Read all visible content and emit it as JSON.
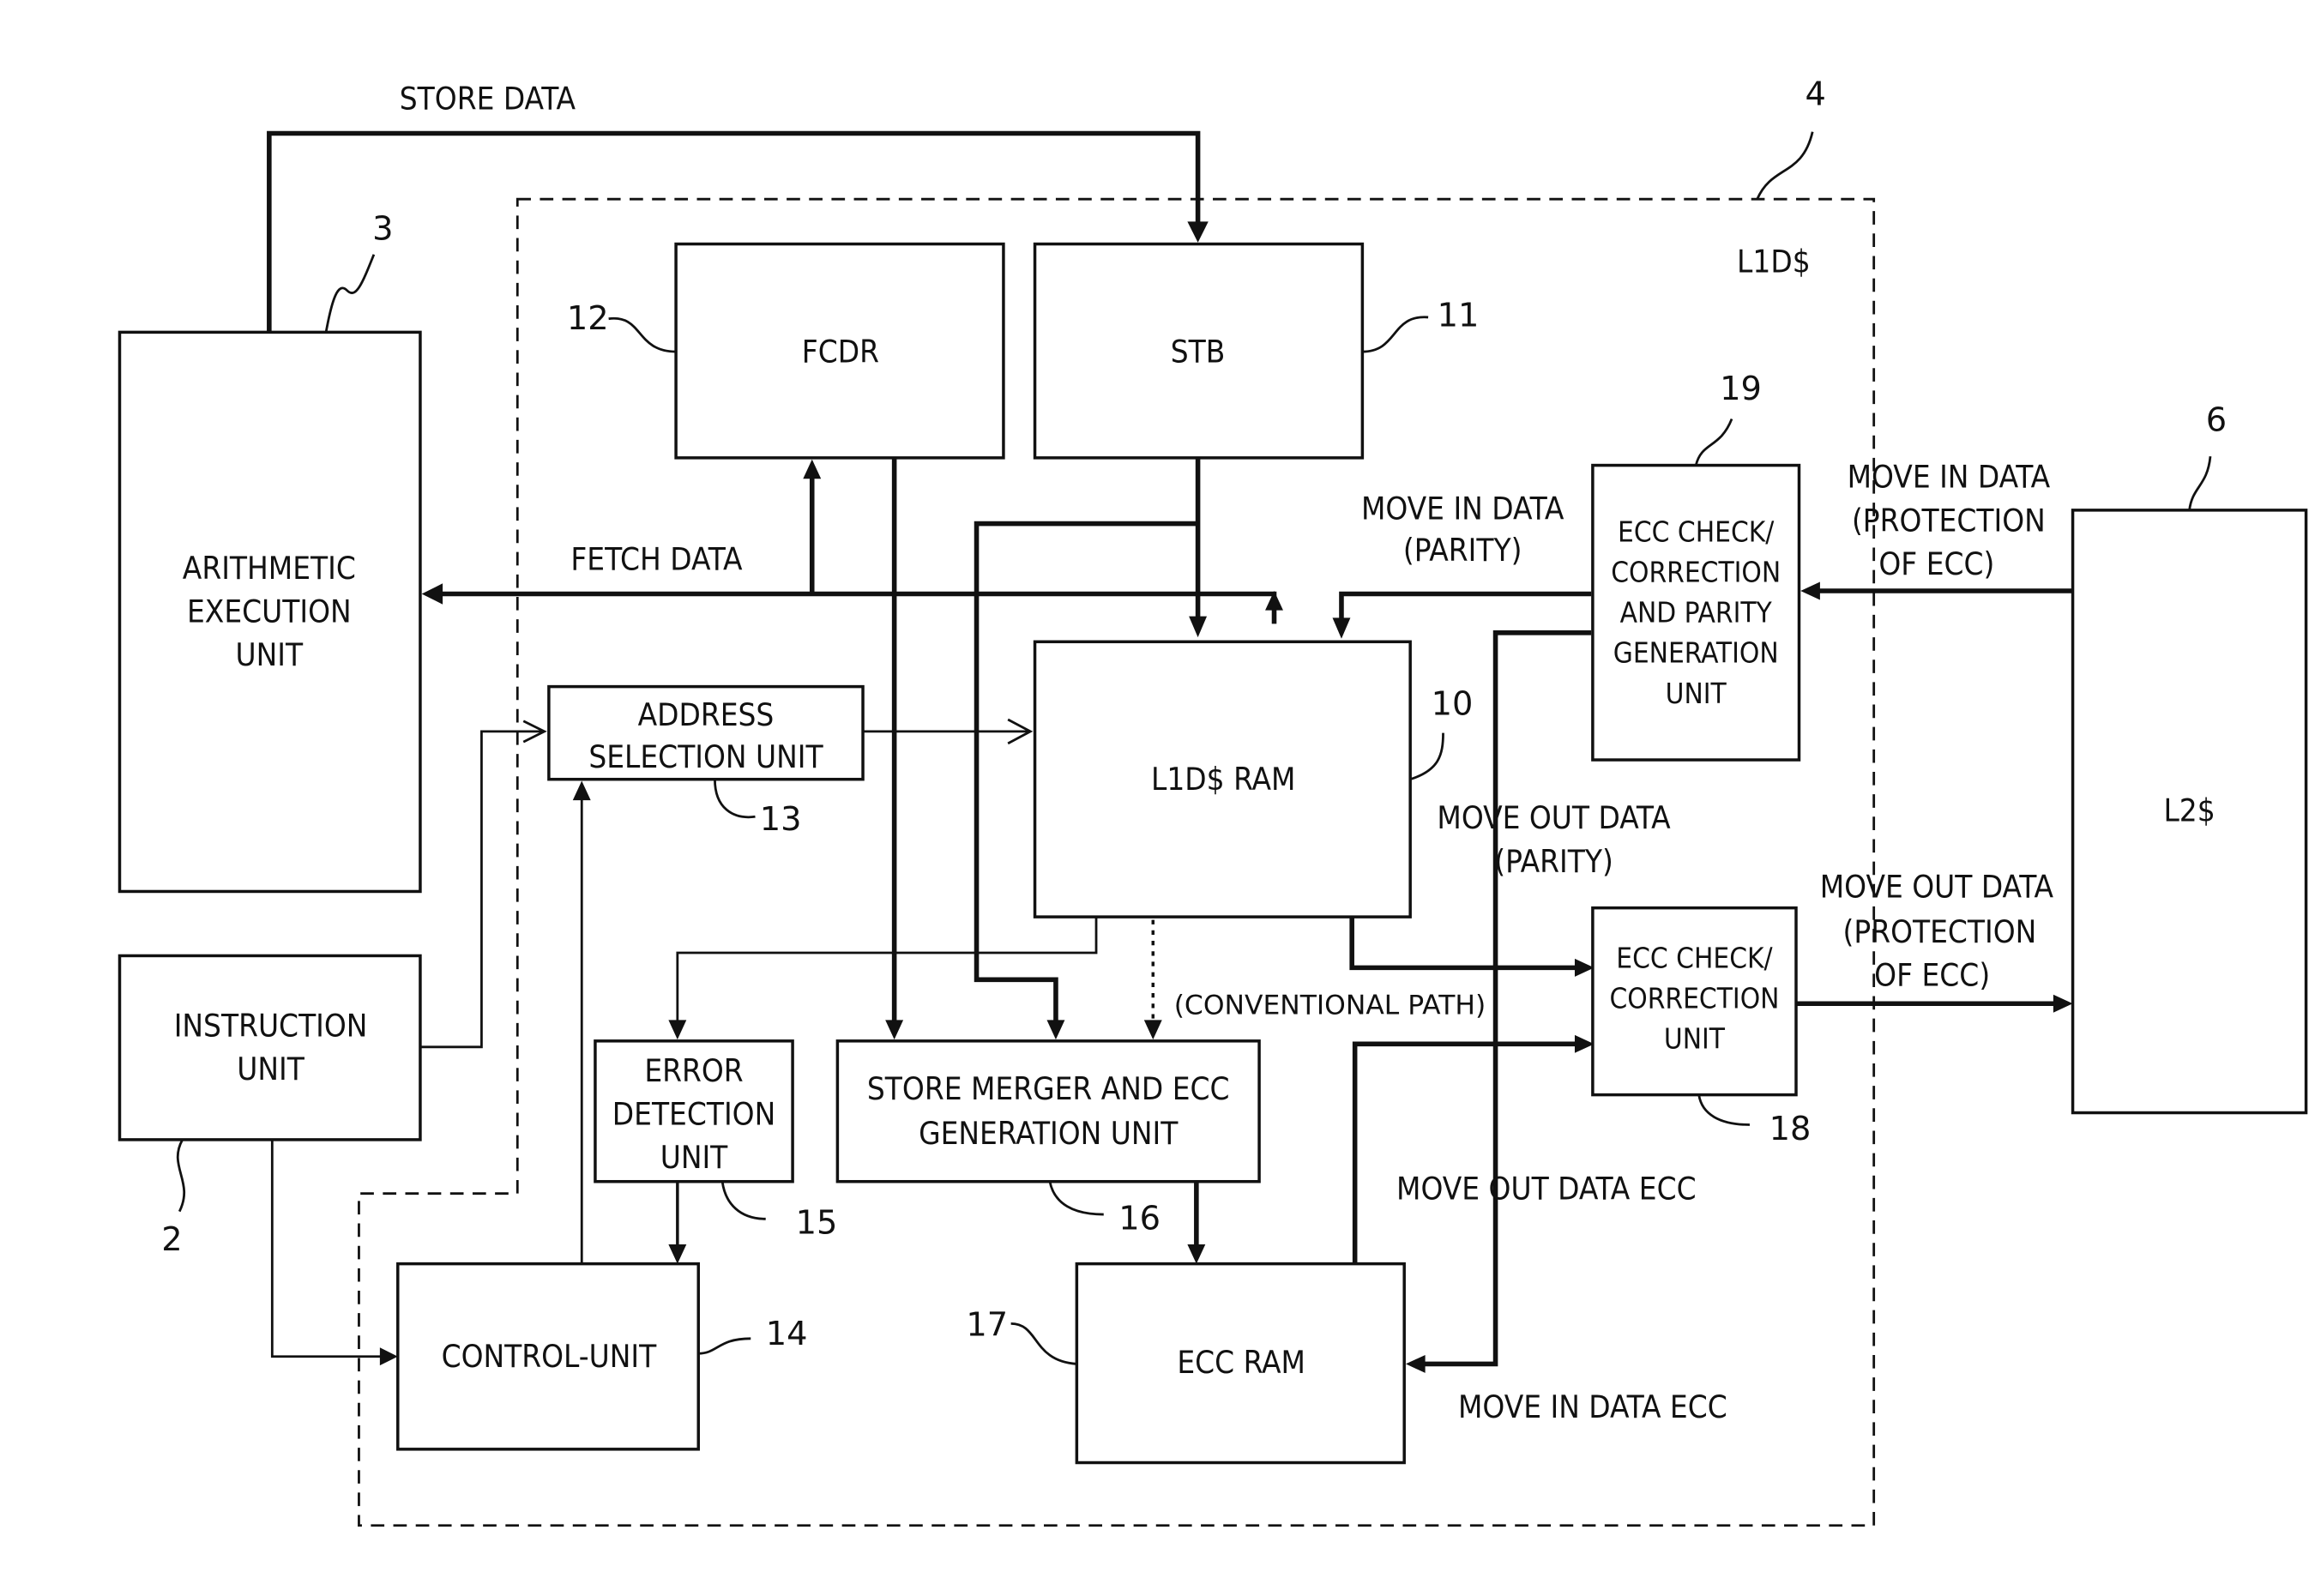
{
  "diagram": {
    "boundary": {
      "ref": "4",
      "label": "L1D$"
    },
    "blocks": {
      "arithmetic": {
        "lines": [
          "ARITHMETIC",
          "EXECUTION",
          "UNIT"
        ],
        "ref": "3"
      },
      "instruction": {
        "lines": [
          "INSTRUCTION",
          "UNIT"
        ],
        "ref": "2"
      },
      "fcdr": {
        "lines": [
          "FCDR"
        ],
        "ref": "12"
      },
      "stb": {
        "lines": [
          "STB"
        ],
        "ref": "11"
      },
      "address": {
        "lines": [
          "ADDRESS",
          "SELECTION UNIT"
        ],
        "ref": "13"
      },
      "l1d_ram": {
        "lines": [
          "L1D$ RAM"
        ],
        "ref": "10"
      },
      "error_detect": {
        "lines": [
          "ERROR",
          "DETECTION",
          "UNIT"
        ],
        "ref": "15"
      },
      "store_merger": {
        "lines": [
          "STORE MERGER AND ECC",
          "GENERATION UNIT"
        ],
        "ref": "16"
      },
      "control": {
        "lines": [
          "CONTROL-UNIT"
        ],
        "ref": "14"
      },
      "ecc_ram": {
        "lines": [
          "ECC RAM"
        ],
        "ref": "17"
      },
      "ecc_parity": {
        "lines": [
          "ECC CHECK/",
          "CORRECTION",
          "AND PARITY",
          "GENERATION",
          "UNIT"
        ],
        "ref": "19"
      },
      "ecc_check": {
        "lines": [
          "ECC CHECK/",
          "CORRECTION",
          "UNIT"
        ],
        "ref": "18"
      },
      "l2": {
        "lines": [
          "L2$"
        ],
        "ref": "6"
      }
    },
    "signals": {
      "store_data": "STORE DATA",
      "fetch_data": "FETCH DATA",
      "move_in_parity": [
        "MOVE IN DATA",
        "(PARITY)"
      ],
      "move_in_ecc": [
        "MOVE IN DATA",
        "(PROTECTION",
        "OF ECC)"
      ],
      "move_out_parity": [
        "MOVE OUT DATA",
        "(PARITY)"
      ],
      "move_out_ecc": [
        "MOVE OUT DATA",
        "(PROTECTION",
        "OF ECC)"
      ],
      "conventional": "(CONVENTIONAL PATH)",
      "move_out_data_ecc": "MOVE OUT DATA ECC",
      "move_in_data_ecc": "MOVE IN DATA ECC"
    }
  }
}
